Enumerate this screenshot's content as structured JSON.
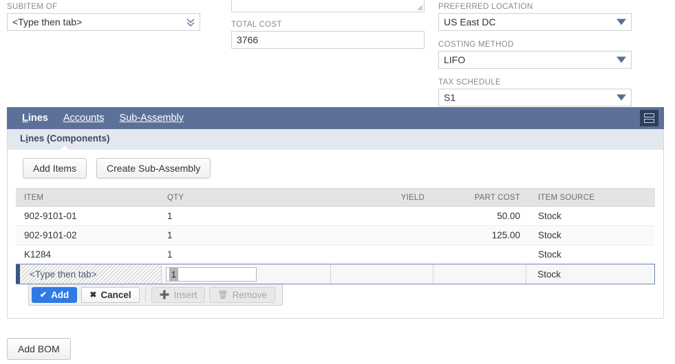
{
  "form": {
    "subitem_of": {
      "label": "SUBITEM OF",
      "value": "<Type then tab>",
      "icon": "double-chevron-down-icon"
    },
    "description": {
      "value": "",
      "placeholder": ""
    },
    "total_cost": {
      "label": "TOTAL COST",
      "value": "3766"
    },
    "preferred_location": {
      "label": "PREFERRED LOCATION",
      "value": "US East DC"
    },
    "costing_method": {
      "label": "COSTING METHOD",
      "value": "LIFO"
    },
    "tax_schedule": {
      "label": "TAX SCHEDULE",
      "value": "S1"
    }
  },
  "tabs": {
    "items": [
      {
        "label": "Lines",
        "accesskey": "L",
        "rest": "ines",
        "active": true
      },
      {
        "label": "Accounts",
        "accesskey": "A",
        "rest": "ccounts",
        "active": false
      },
      {
        "label": "Sub-Assembly",
        "accesskey": "S",
        "rest": "ub-Assembly",
        "active": false
      }
    ],
    "menu_icon": "list-layout-icon"
  },
  "panel": {
    "title": "Lines (Components)",
    "title_pre": "L",
    "title_key": "i",
    "title_post": "nes (Components)",
    "buttons": [
      {
        "label": "Add Items",
        "name": "add-items-button"
      },
      {
        "label": "Create Sub-Assembly",
        "name": "create-sub-assembly-button"
      }
    ]
  },
  "grid": {
    "columns": [
      "ITEM",
      "QTY",
      "YIELD",
      "PART COST",
      "ITEM SOURCE"
    ],
    "rows": [
      {
        "item": "902-9101-01",
        "qty": "1",
        "yield": "",
        "part_cost": "50.00",
        "item_source": "Stock"
      },
      {
        "item": "902-9101-02",
        "qty": "1",
        "yield": "",
        "part_cost": "125.00",
        "item_source": "Stock"
      },
      {
        "item": "K1284",
        "qty": "1",
        "yield": "",
        "part_cost": "",
        "item_source": "Stock"
      }
    ],
    "edit_row": {
      "item_placeholder": "<Type then tab>",
      "qty_value": "1",
      "yield": "",
      "part_cost": "",
      "item_source": "Stock"
    }
  },
  "actions": {
    "add": {
      "label": "Add",
      "icon": "check-icon",
      "enabled": true
    },
    "cancel": {
      "label": "Cancel",
      "icon": "cross-icon",
      "enabled": true
    },
    "insert": {
      "label": "Insert",
      "icon": "plus-icon",
      "enabled": false
    },
    "remove": {
      "label": "Remove",
      "icon": "trash-icon",
      "enabled": false
    }
  },
  "footer": {
    "add_bom": "Add BOM"
  },
  "colors": {
    "tabbar": "#5d7099",
    "panel_head": "#e3e7ef",
    "accent_blue": "#2f7ae5",
    "marker": "#3e5680"
  }
}
